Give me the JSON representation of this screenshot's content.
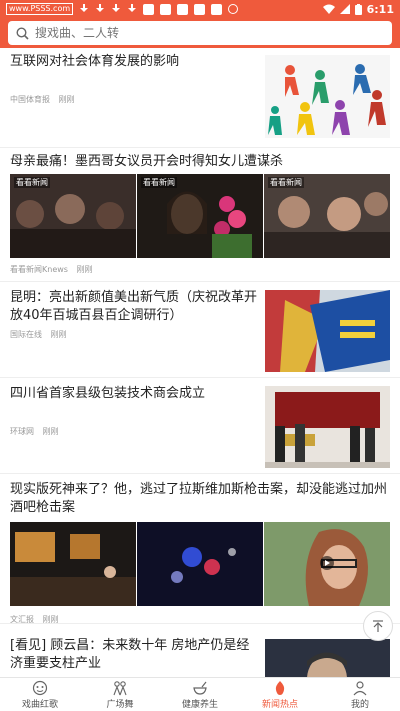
{
  "status_bar": {
    "badge": "www.PSSS.com",
    "time": "6:11"
  },
  "search": {
    "placeholder": "搜戏曲、二人转"
  },
  "articles": [
    {
      "title": "互联网对社会体育发展的影响",
      "source": "中国体育报",
      "time": "刚刚"
    },
    {
      "title": "母亲最痛！墨西哥女议员开会时得知女儿遭谋杀",
      "source": "看看新闻Knews",
      "time": "刚刚",
      "watermarks": [
        "看看新闻",
        "看看新闻",
        "看看新闻"
      ]
    },
    {
      "title": "昆明：亮出新颜值美出新气质（庆祝改革开放40年百城百县百企调研行）",
      "source": "国际在线",
      "time": "刚刚"
    },
    {
      "title": "四川省首家县级包装技术商会成立",
      "source": "环球网",
      "time": "刚刚"
    },
    {
      "title": "现实版死神来了？他，逃过了拉斯维加斯枪击案，却没能逃过加州酒吧枪击案",
      "source": "文汇报",
      "time": "刚刚"
    },
    {
      "title": "[看见] 顾云昌：未来数十年 房地产仍是经济重要支柱产业"
    }
  ],
  "nav": {
    "items": [
      {
        "label": "戏曲红歌",
        "icon": "opera-mask-icon"
      },
      {
        "label": "广场舞",
        "icon": "dancers-icon"
      },
      {
        "label": "健康养生",
        "icon": "health-bowl-icon"
      },
      {
        "label": "新闻热点",
        "icon": "news-icon"
      },
      {
        "label": "我的",
        "icon": "profile-icon"
      }
    ]
  },
  "colors": {
    "brand": "#ef5a3c",
    "muted": "#999999"
  }
}
